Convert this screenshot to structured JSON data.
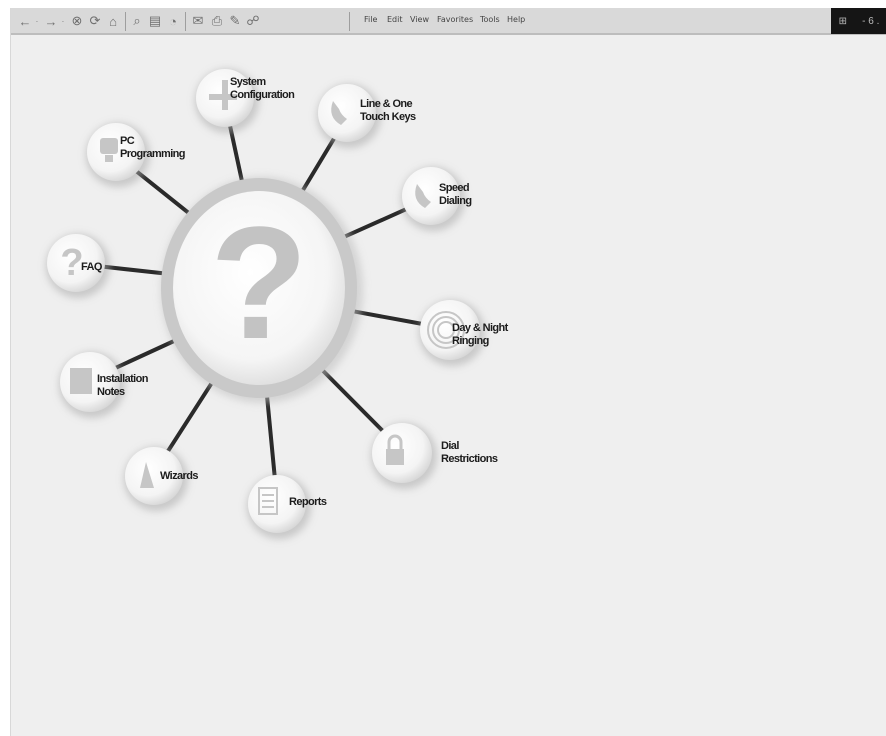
{
  "browser": {
    "menu": [
      {
        "id": "file",
        "label": "File"
      },
      {
        "id": "edit",
        "label": "Edit"
      },
      {
        "id": "view",
        "label": "View"
      },
      {
        "id": "favorites",
        "label": "Favorites"
      },
      {
        "id": "tools",
        "label": "Tools"
      },
      {
        "id": "help",
        "label": "Help"
      }
    ],
    "toolbar_icons": [
      "back-arrow-icon",
      "dropdown-icon",
      "forward-arrow-icon",
      "dropdown-icon",
      "stop-icon",
      "refresh-icon",
      "home-icon",
      "search-icon",
      "favorites-icon",
      "history-icon",
      "mail-icon",
      "print-icon",
      "edit-icon",
      "discuss-icon"
    ],
    "throbber_icon": "windows-logo-icon",
    "throbber_text": "- 6 ."
  },
  "hub": {
    "center_icon": "question-mark-icon",
    "center_glyph": "?",
    "nodes": [
      {
        "id": "system-configuration",
        "lines": [
          "System",
          "Configuration"
        ],
        "icon": "plus-icon"
      },
      {
        "id": "line-one-touch-keys",
        "lines": [
          "Line & One",
          "Touch Keys"
        ],
        "icon": "phone-icon"
      },
      {
        "id": "speed-dialing",
        "lines": [
          "Speed",
          "Dialing"
        ],
        "icon": "phone-handset-icon"
      },
      {
        "id": "day-night-ringing",
        "lines": [
          "Day & Night",
          "Ringing"
        ],
        "icon": "ring-waves-icon"
      },
      {
        "id": "dial-restrictions",
        "lines": [
          "Dial",
          "Restrictions"
        ],
        "icon": "padlock-icon"
      },
      {
        "id": "reports",
        "lines": [
          "Reports"
        ],
        "icon": "document-icon"
      },
      {
        "id": "wizards",
        "lines": [
          "Wizards"
        ],
        "icon": "wizard-hat-icon"
      },
      {
        "id": "installation-notes",
        "lines": [
          "Installation",
          "Notes"
        ],
        "icon": "notepad-icon"
      },
      {
        "id": "faq",
        "lines": [
          "FAQ"
        ],
        "icon": "question-mark-icon"
      },
      {
        "id": "pc-programming",
        "lines": [
          "PC",
          "Programming"
        ],
        "icon": "monitor-icon"
      }
    ]
  },
  "colors": {
    "page_bg": "#efefef",
    "toolbar_bg": "#d9d9d9",
    "spoke": "#2a2a2a",
    "hub_ring": "#c7c7c7",
    "hub_core": "#fbfbfb",
    "glyph": "#c2c2c2"
  }
}
